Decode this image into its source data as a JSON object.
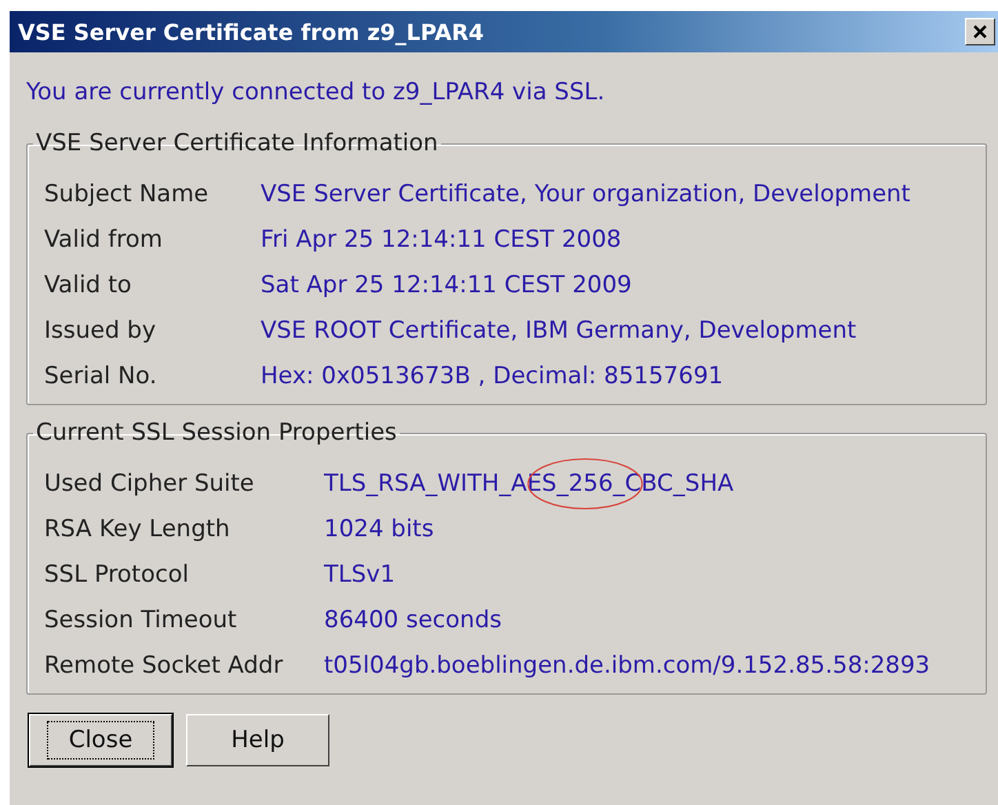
{
  "window": {
    "title": "VSE Server Certificate from z9_LPAR4"
  },
  "connection_text": "You are currently connected to z9_LPAR4 via SSL.",
  "certificate_group": {
    "title": "VSE Server Certificate Information",
    "rows": [
      {
        "label": "Subject Name",
        "value": "VSE Server Certificate, Your organization, Development"
      },
      {
        "label": "Valid from",
        "value": "Fri Apr 25 12:14:11 CEST 2008"
      },
      {
        "label": "Valid to",
        "value": "Sat Apr 25 12:14:11 CEST 2009"
      },
      {
        "label": "Issued by",
        "value": "VSE ROOT Certificate, IBM Germany, Development"
      },
      {
        "label": "Serial No.",
        "value": "Hex: 0x0513673B ,  Decimal: 85157691"
      }
    ]
  },
  "session_group": {
    "title": "Current SSL Session Properties",
    "rows": [
      {
        "label": "Used Cipher Suite",
        "value": "TLS_RSA_WITH_AES_256_CBC_SHA",
        "highlighted": true
      },
      {
        "label": "RSA Key Length",
        "value": "1024 bits",
        "highlighted": false
      },
      {
        "label": "SSL Protocol",
        "value": "TLSv1",
        "highlighted": false
      },
      {
        "label": "Session Timeout",
        "value": "86400 seconds",
        "highlighted": false
      },
      {
        "label": "Remote Socket Addr",
        "value": "t05l04gb.boeblingen.de.ibm.com/9.152.85.58:2893",
        "highlighted": false
      }
    ]
  },
  "buttons": [
    {
      "label": "Close",
      "selected": true
    },
    {
      "label": "Help",
      "selected": false
    }
  ]
}
